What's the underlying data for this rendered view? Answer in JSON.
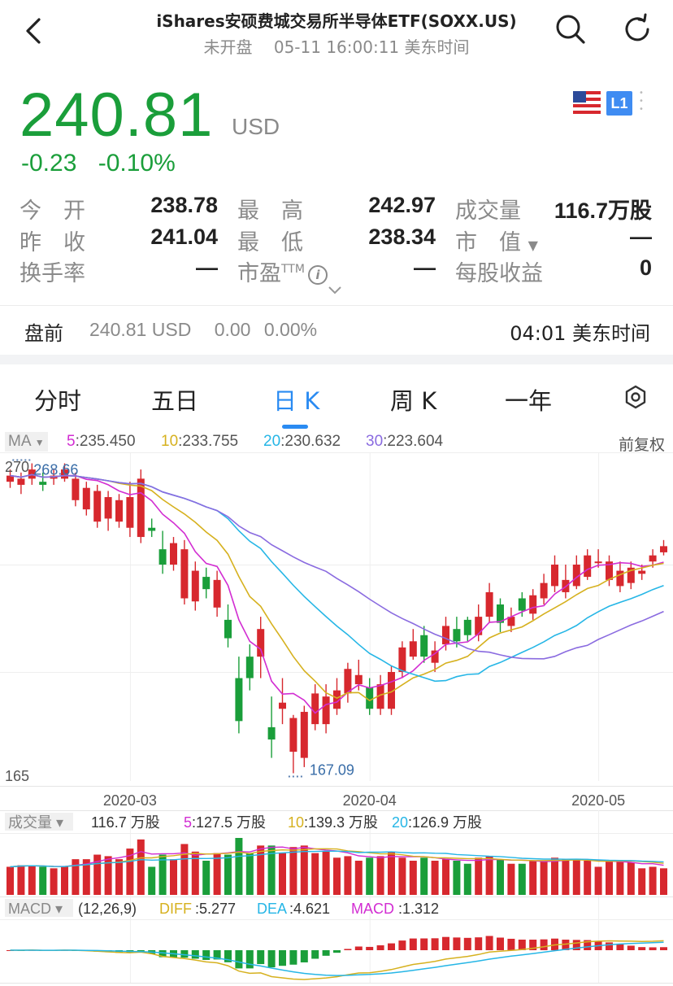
{
  "header": {
    "title": "iShares安硕费城交易所半导体ETF(SOXX.US)",
    "status": "未开盘",
    "datetime": "05-11 16:00:11 美东时间"
  },
  "quote": {
    "price": "240.81",
    "currency": "USD",
    "change": "-0.23",
    "change_pct": "-0.10%",
    "badge": "L1",
    "up_color": "#d7282e",
    "down_color": "#1a9e3a"
  },
  "stats": {
    "open_label": "今　开",
    "open": "238.78",
    "high_label": "最　高",
    "high": "242.97",
    "volume_label": "成交量",
    "volume": "116.7万股",
    "prev_label": "昨　收",
    "prev": "241.04",
    "low_label": "最　低",
    "low": "238.34",
    "mcap_label": "市　值",
    "mcap": "—",
    "turnover_label": "换手率",
    "turnover": "—",
    "pe_label": "市盈",
    "pe_sup": "TTM",
    "pe": "—",
    "eps_label": "每股收益",
    "eps": "0"
  },
  "premarket": {
    "label": "盘前",
    "price": "240.81 USD",
    "change": "0.00",
    "change_pct": "0.00%",
    "time": "04:01 美东时间"
  },
  "tabs": [
    "分时",
    "五日",
    "日 K",
    "周 K",
    "一年"
  ],
  "active_tab": "日 K",
  "ma_legend": {
    "selector": "MA",
    "items": [
      {
        "key": "5",
        "value": "235.450",
        "color": "#d22dd2"
      },
      {
        "key": "10",
        "value": "233.755",
        "color": "#d6b11f"
      },
      {
        "key": "20",
        "value": "230.632",
        "color": "#26b6e6"
      },
      {
        "key": "30",
        "value": "223.604",
        "color": "#8a6be0"
      }
    ],
    "adjust": "前复权"
  },
  "price_axis": {
    "top": "270",
    "bottom": "165"
  },
  "annotations": {
    "max": "268.66",
    "min": "167.09"
  },
  "date_labels": [
    "2020-03",
    "2020-04",
    "2020-05"
  ],
  "volume_legend": {
    "selector": "成交量",
    "current": "116.7 万股",
    "items": [
      {
        "key": "5",
        "value": "127.5 万股",
        "color": "#d22dd2"
      },
      {
        "key": "10",
        "value": "139.3 万股",
        "color": "#d6b11f"
      },
      {
        "key": "20",
        "value": "126.9 万股",
        "color": "#26b6e6"
      }
    ]
  },
  "macd_legend": {
    "selector": "MACD",
    "params": "(12,26,9)",
    "diff_label": "DIFF",
    "diff": "5.277",
    "dea_label": "DEA",
    "dea": "4.621",
    "macd_label": "MACD",
    "macd": "1.312",
    "diff_color": "#d6b11f",
    "dea_color": "#26b6e6",
    "macd_color": "#d22dd2"
  },
  "chart_data": {
    "type": "candlestick",
    "x": [
      "2020-02-13",
      "2020-02-14",
      "2020-02-18",
      "2020-02-19",
      "2020-02-20",
      "2020-02-21",
      "2020-02-24",
      "2020-02-25",
      "2020-02-26",
      "2020-02-27",
      "2020-02-28",
      "2020-03-02",
      "2020-03-03",
      "2020-03-04",
      "2020-03-05",
      "2020-03-06",
      "2020-03-09",
      "2020-03-10",
      "2020-03-11",
      "2020-03-12",
      "2020-03-13",
      "2020-03-16",
      "2020-03-17",
      "2020-03-18",
      "2020-03-19",
      "2020-03-20",
      "2020-03-23",
      "2020-03-24",
      "2020-03-25",
      "2020-03-26",
      "2020-03-27",
      "2020-03-30",
      "2020-03-31",
      "2020-04-01",
      "2020-04-02",
      "2020-04-03",
      "2020-04-06",
      "2020-04-07",
      "2020-04-08",
      "2020-04-09",
      "2020-04-13",
      "2020-04-14",
      "2020-04-15",
      "2020-04-16",
      "2020-04-17",
      "2020-04-20",
      "2020-04-21",
      "2020-04-22",
      "2020-04-23",
      "2020-04-24",
      "2020-04-27",
      "2020-04-28",
      "2020-04-29",
      "2020-04-30",
      "2020-05-01",
      "2020-05-04",
      "2020-05-05",
      "2020-05-06",
      "2020-05-07",
      "2020-05-08",
      "2020-05-11"
    ],
    "open": [
      262,
      261,
      263,
      262,
      263,
      263,
      256,
      253,
      249,
      250,
      249,
      247,
      244,
      247,
      240,
      235,
      224,
      223,
      231,
      221,
      217,
      198,
      205,
      205,
      182,
      188,
      174,
      172,
      183,
      183,
      188,
      193,
      196,
      195,
      188,
      188,
      200,
      205,
      212,
      203,
      209,
      214,
      217,
      212,
      218,
      222,
      215,
      224,
      219,
      224,
      228,
      226,
      228,
      231,
      236,
      230,
      228,
      229,
      232,
      236,
      239
    ],
    "close": [
      264,
      263,
      266,
      261,
      264,
      266,
      263,
      260,
      259,
      257,
      256,
      257,
      263,
      246,
      235,
      242,
      240,
      233,
      227,
      230,
      211,
      184,
      198,
      214,
      178,
      190,
      185,
      187,
      193,
      192,
      194,
      201,
      199,
      188,
      196,
      200,
      208,
      210,
      205,
      207,
      215,
      210,
      212,
      218,
      226,
      216,
      218,
      220,
      225,
      229,
      235,
      230,
      235,
      238,
      236,
      236,
      233,
      234,
      233,
      238,
      241
    ],
    "high": [
      266,
      265,
      268,
      265,
      266,
      268,
      265,
      262,
      261,
      259,
      258,
      262,
      266,
      250,
      246,
      244,
      243,
      236,
      234,
      233,
      222,
      205,
      209,
      218,
      192,
      198,
      186,
      189,
      196,
      196,
      198,
      203,
      204,
      198,
      199,
      202,
      210,
      214,
      215,
      210,
      218,
      218,
      218,
      222,
      229,
      224,
      221,
      226,
      227,
      232,
      238,
      235,
      238,
      240,
      240,
      238,
      236,
      236,
      235,
      240,
      243
    ],
    "low": [
      260,
      258,
      261,
      259,
      261,
      262,
      254,
      251,
      247,
      246,
      247,
      244,
      242,
      244,
      232,
      233,
      222,
      220,
      224,
      218,
      208,
      180,
      194,
      198,
      172,
      183,
      167,
      169,
      181,
      180,
      186,
      190,
      194,
      186,
      186,
      186,
      198,
      204,
      203,
      200,
      207,
      208,
      210,
      210,
      216,
      213,
      213,
      218,
      217,
      222,
      226,
      224,
      227,
      230,
      234,
      228,
      226,
      227,
      230,
      234,
      238
    ],
    "ylim": [
      165,
      270
    ],
    "max_label": 268.66,
    "min_label": 167.09,
    "volume_current": "116.7 万股",
    "macd": {
      "DIFF": 5.277,
      "DEA": 4.621,
      "MACD": 1.312
    }
  }
}
